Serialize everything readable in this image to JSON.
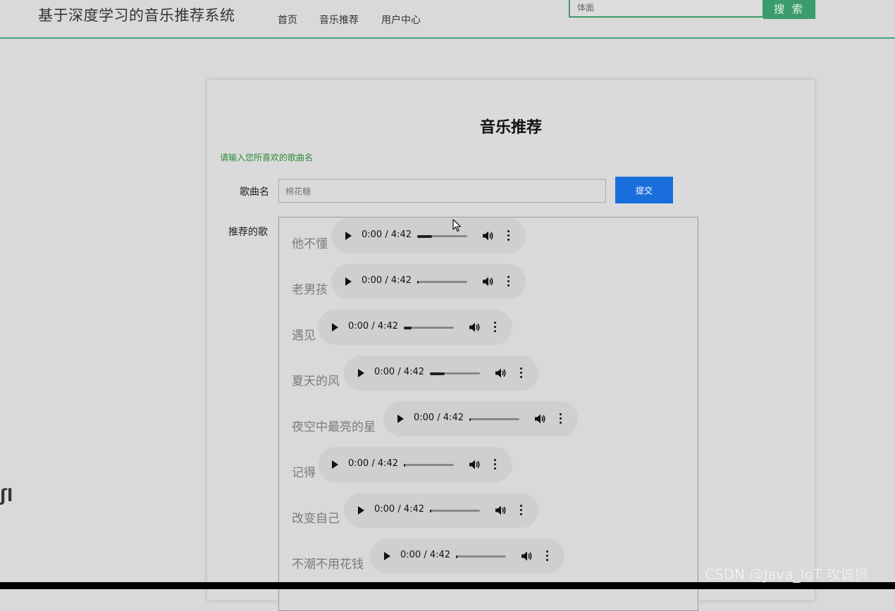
{
  "site": {
    "title": "基于深度学习的音乐推荐系统",
    "nav": [
      "首页",
      "音乐推荐",
      "用户中心"
    ],
    "search_placeholder": "体面",
    "search_button": "搜 索"
  },
  "card": {
    "title": "音乐推荐",
    "hint": "请输入您所喜欢的歌曲名",
    "song_label": "歌曲名",
    "song_input_value": "棉花糖",
    "submit_label": "提交",
    "recommend_label": "推荐的歌"
  },
  "recommendations": [
    {
      "name": "他不懂",
      "time": "0:00 / 4:42",
      "progress": 0.3
    },
    {
      "name": "老男孩",
      "time": "0:00 / 4:42",
      "progress": 0.02
    },
    {
      "name": "遇见",
      "time": "0:00 / 4:42",
      "progress": 0.15
    },
    {
      "name": "夏天的风",
      "time": "0:00 / 4:42",
      "progress": 0.3
    },
    {
      "name": "夜空中最亮的星",
      "time": "0:00 / 4:42",
      "progress": 0.0
    },
    {
      "name": "记得",
      "time": "0:00 / 4:42",
      "progress": 0.0
    },
    {
      "name": "改变自己",
      "time": "0:00 / 4:42",
      "progress": 0.0
    },
    {
      "name": "不潮不用花钱",
      "time": "0:00 / 4:42",
      "progress": 0.0
    }
  ],
  "watermark": "CSDN @Java_IoT 攻诚狮",
  "left_glyph": "ʃl",
  "colors": {
    "accent_green": "#3d9c6b",
    "submit_blue": "#1a6edb",
    "hint_green": "#2d8a3a"
  }
}
